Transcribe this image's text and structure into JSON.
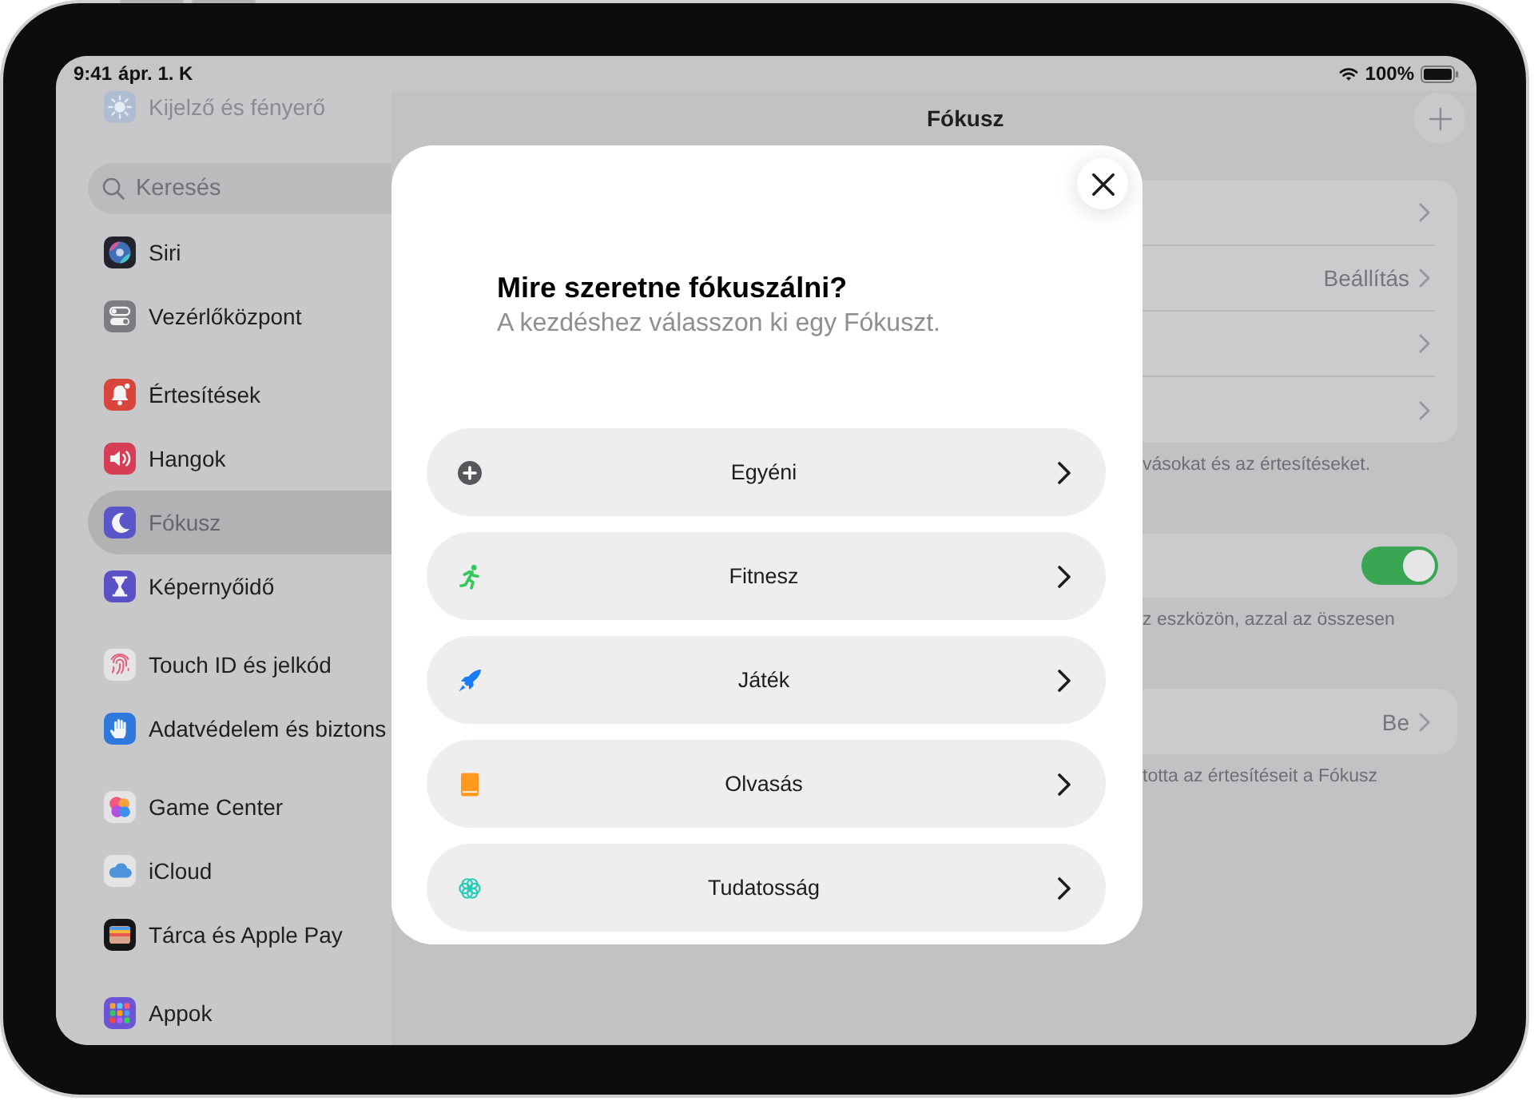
{
  "status_bar": {
    "time": "9:41",
    "date": "ápr. 1. K",
    "battery": "100%"
  },
  "sidebar": {
    "faded_item": {
      "label": "Kijelző és fényerő"
    },
    "search": {
      "placeholder": "Keresés"
    },
    "groups": [
      {
        "items": [
          {
            "label": "Siri",
            "selected": false
          },
          {
            "label": "Vezérlőközpont",
            "selected": false
          }
        ]
      },
      {
        "items": [
          {
            "label": "Értesítések",
            "selected": false
          },
          {
            "label": "Hangok",
            "selected": false
          },
          {
            "label": "Fókusz",
            "selected": true
          },
          {
            "label": "Képernyőidő",
            "selected": false
          }
        ]
      },
      {
        "items": [
          {
            "label": "Touch ID és jelkód",
            "selected": false
          },
          {
            "label": "Adatvédelem és biztons",
            "selected": false
          }
        ]
      },
      {
        "items": [
          {
            "label": "Game Center",
            "selected": false
          },
          {
            "label": "iCloud",
            "selected": false
          },
          {
            "label": "Tárca és Apple Pay",
            "selected": false
          }
        ]
      },
      {
        "items": [
          {
            "label": "Appok",
            "selected": false
          }
        ]
      }
    ]
  },
  "detail": {
    "title": "Fókusz",
    "sections": [
      {
        "rows": [
          {
            "kind": "link"
          },
          {
            "kind": "link",
            "value": "Beállítás"
          },
          {
            "kind": "link"
          },
          {
            "kind": "link"
          }
        ],
        "footer": "vásokat és az értesítéseket."
      },
      {
        "rows": [
          {
            "kind": "toggle",
            "on": true
          }
        ],
        "footer": "z eszközön, azzal az összesen"
      },
      {
        "rows": [
          {
            "kind": "link",
            "value": "Be"
          }
        ],
        "footer": "totta az értesítéseit a Fókusz"
      }
    ]
  },
  "dialog": {
    "title": "Mire szeretne fókuszálni?",
    "subtitle": "A kezdéshez válasszon ki egy Fókuszt.",
    "options": [
      {
        "label": "Egyéni"
      },
      {
        "label": "Fitnesz"
      },
      {
        "label": "Játék"
      },
      {
        "label": "Olvasás"
      },
      {
        "label": "Tudatosság"
      }
    ]
  }
}
